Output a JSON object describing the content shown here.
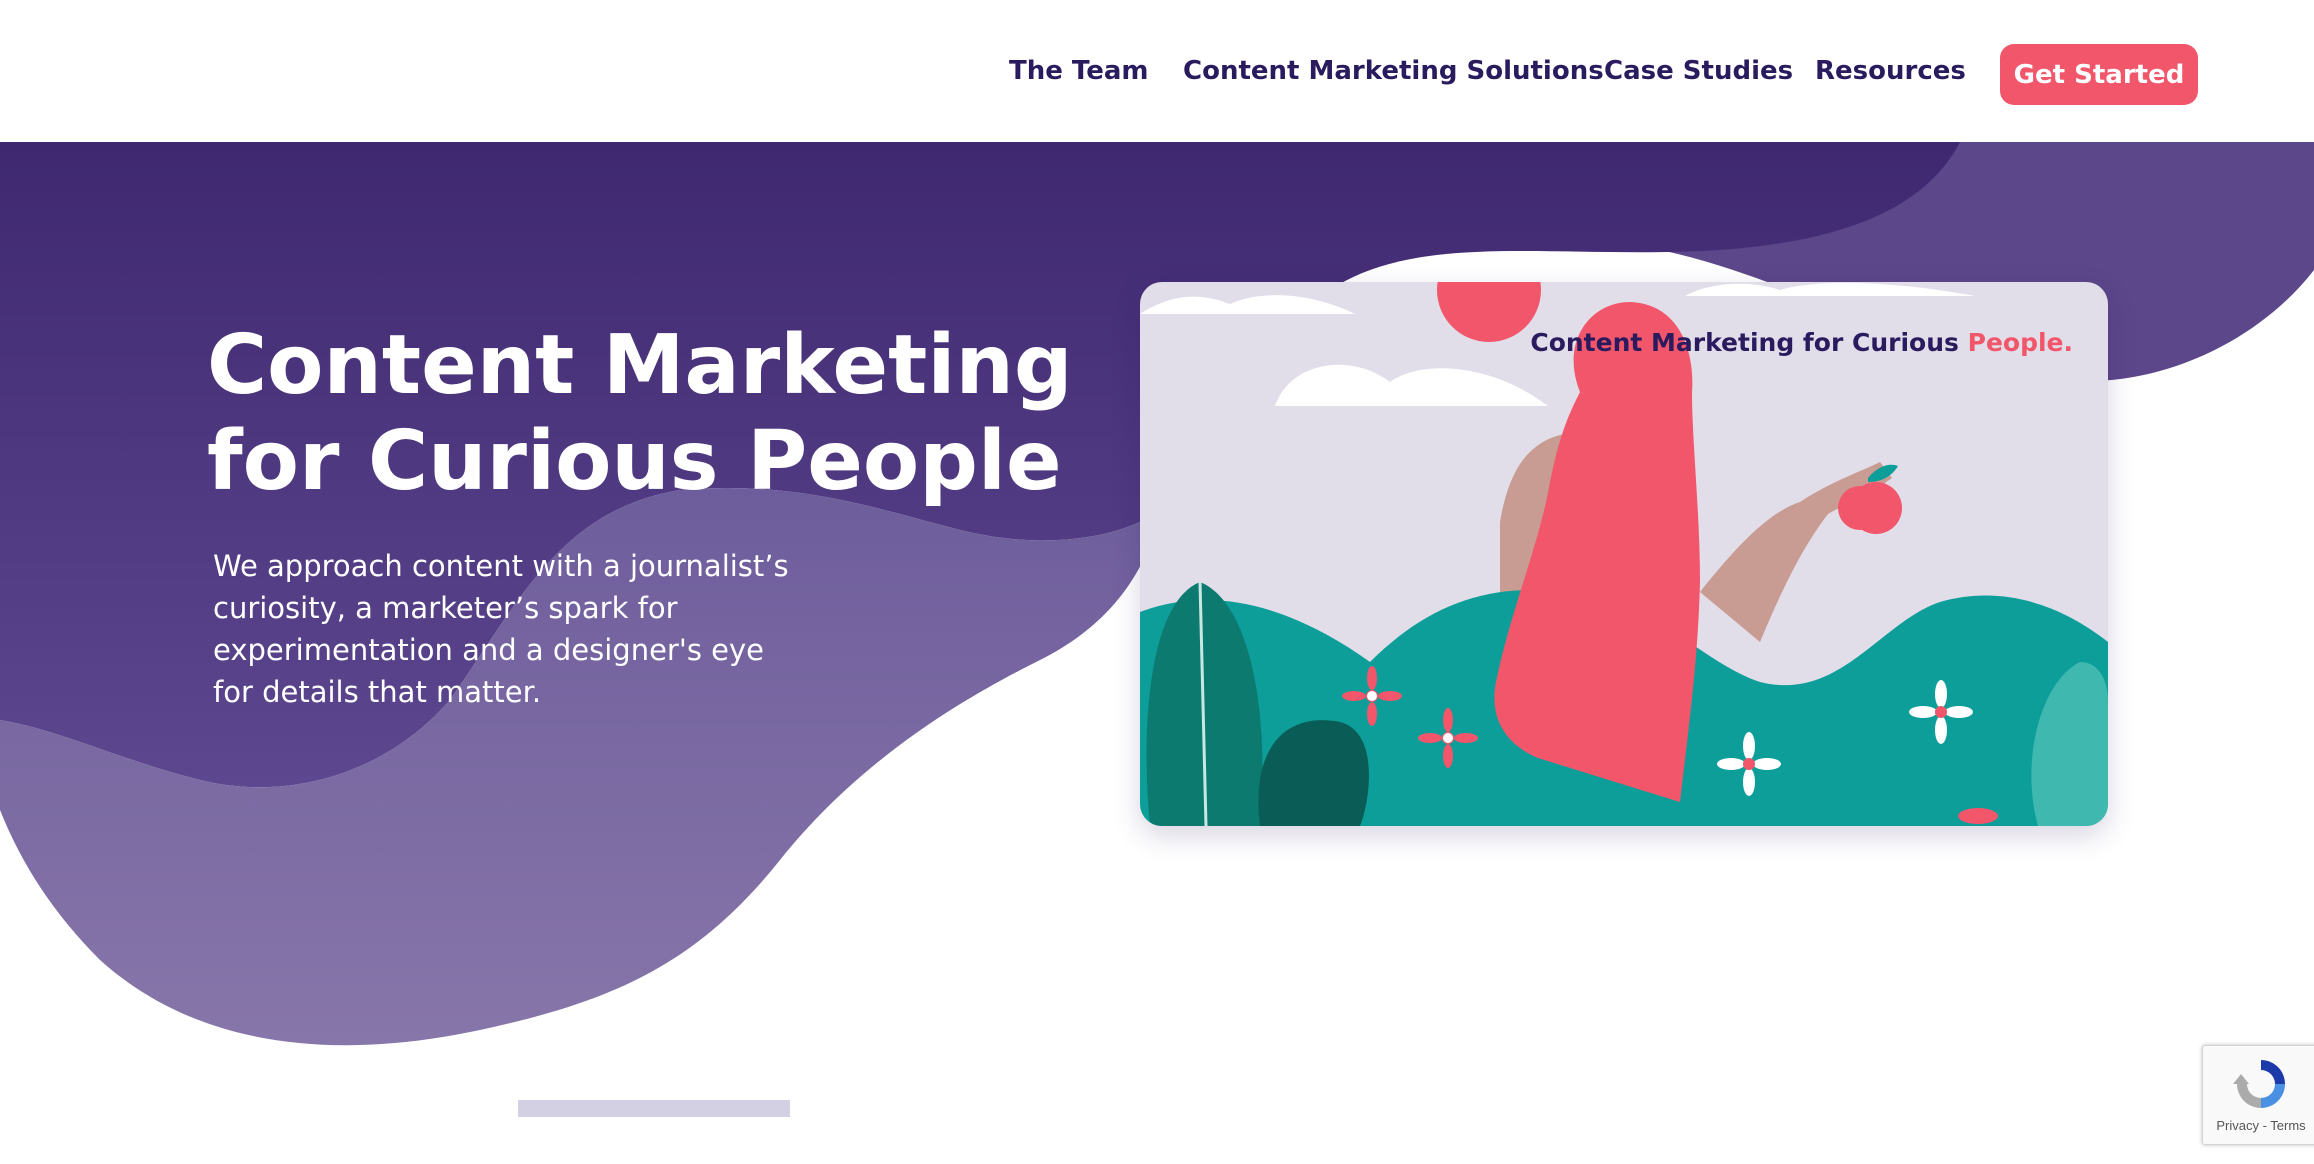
{
  "nav": {
    "items": [
      {
        "label": "The Team"
      },
      {
        "label": "Content Marketing Solutions"
      },
      {
        "label": "Case Studies"
      },
      {
        "label": "Resources"
      }
    ],
    "cta_label": "Get Started"
  },
  "hero": {
    "title_line1": "Content Marketing",
    "title_line2": "for Curious People",
    "description": "We approach content with a journalist’s curiosity, a marketer’s spark for experimentation and a designer's eye for details that matter."
  },
  "card": {
    "caption_main": "Content Marketing for Curious ",
    "caption_accent": "People."
  },
  "recaptcha": {
    "privacy": "Privacy",
    "separator": " - ",
    "terms": "Terms"
  },
  "colors": {
    "brand_purple": "#3f2870",
    "accent_coral": "#f2566a",
    "teal": "#0d9e9a",
    "nav_text": "#2a1a5e"
  },
  "icons": [
    "recaptcha-icon"
  ]
}
